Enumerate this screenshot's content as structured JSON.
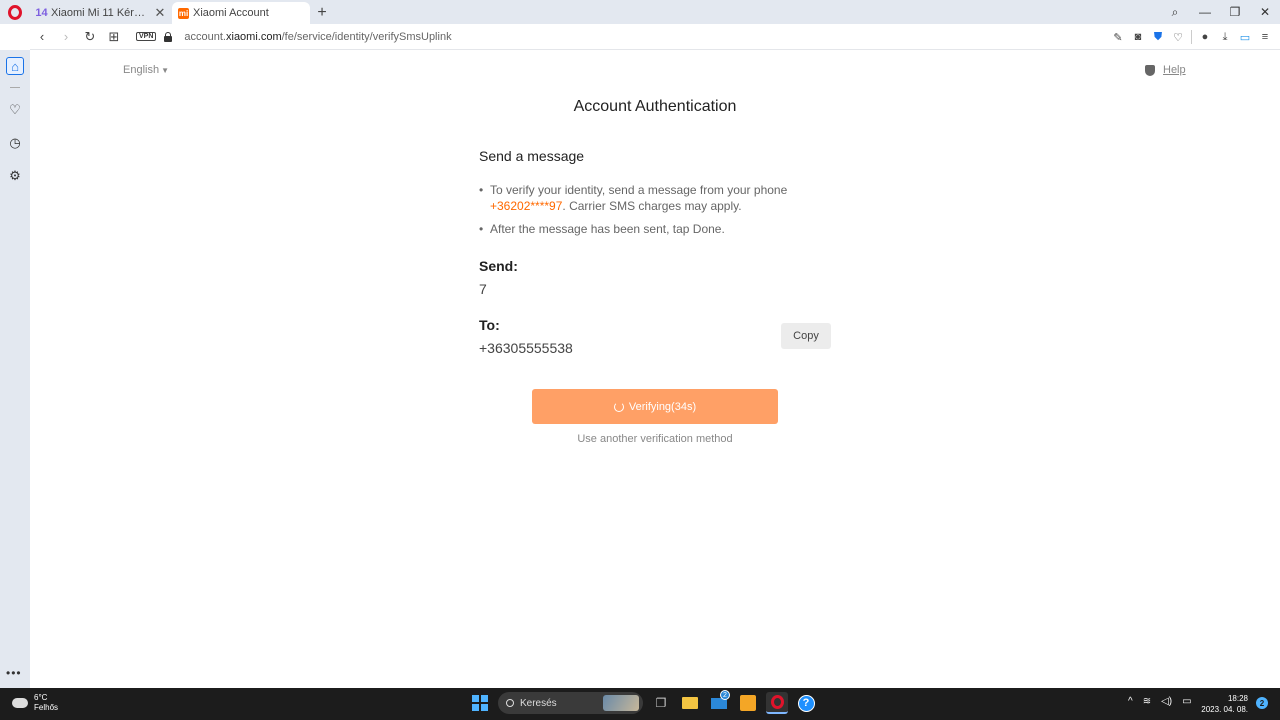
{
  "browser": {
    "tabs": [
      {
        "title": "Xiaomi Mi 11 Kérdések, v",
        "favicon": "s14",
        "active": false
      },
      {
        "title": "Xiaomi Account",
        "favicon": "mi",
        "active": true
      }
    ],
    "new_tab_glyph": "+",
    "vpn_label": "VPN",
    "url": {
      "prefix": "account.",
      "domain": "xiaomi.com",
      "path": "/fe/service/identity/verifySmsUplink"
    }
  },
  "sidebar": {
    "items": [
      "home-icon",
      "heart-icon",
      "history-icon",
      "settings-icon"
    ],
    "more": "•••"
  },
  "page": {
    "language": "English",
    "help_label": "Help",
    "title": "Account Authentication",
    "section_title": "Send a message",
    "bullet1_prefix": "To verify your identity, send a message from your phone",
    "bullet1_phone": "+36202****97",
    "bullet1_suffix": ". Carrier SMS charges may apply.",
    "bullet2": "After the message has been sent, tap Done.",
    "send_label": "Send:",
    "send_value": "7",
    "to_label": "To:",
    "to_value": "+36305555538",
    "copy_label": "Copy",
    "verify_label": "Verifying(34s)",
    "other_method": "Use another verification method",
    "accent_color": "#ff6900",
    "button_color": "#ffa066"
  },
  "taskbar": {
    "weather_temp": "6°C",
    "weather_desc": "Felhős",
    "search_label": "Keresés",
    "mail_badge": "2",
    "time": "18:28",
    "date": "2023. 04. 08.",
    "notification_count": "2"
  }
}
